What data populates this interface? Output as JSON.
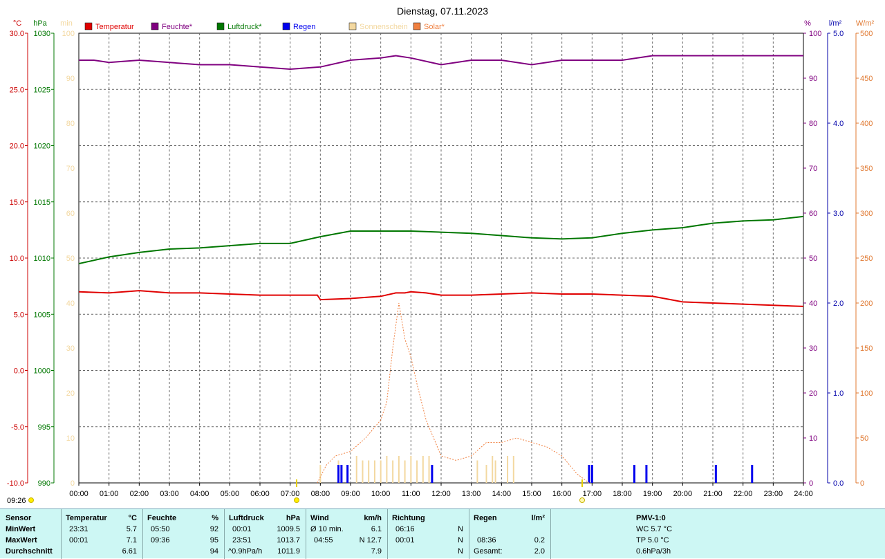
{
  "title": "Dienstag, 07.11.2023",
  "axes": {
    "temp": {
      "unit": "°C",
      "ticks": [
        "30.0",
        "25.0",
        "20.0",
        "15.0",
        "10.0",
        "5.0",
        "0.0",
        "-5.0",
        "-10.0"
      ],
      "color": "#cc0000"
    },
    "pres": {
      "unit": "hPa",
      "ticks": [
        "1030",
        "1025",
        "1020",
        "1015",
        "1010",
        "1005",
        "1000",
        "995",
        "990"
      ],
      "color": "#007700"
    },
    "min": {
      "unit": "min",
      "ticks": [
        "100",
        "90",
        "80",
        "70",
        "60",
        "50",
        "40",
        "30",
        "20",
        "10",
        "0"
      ],
      "color": "#f3d8a0"
    },
    "hum": {
      "unit": "%",
      "ticks": [
        "100",
        "90",
        "80",
        "70",
        "60",
        "50",
        "40",
        "30",
        "20",
        "10",
        "0"
      ],
      "color": "#800080"
    },
    "rain": {
      "unit": "l/m²",
      "ticks": [
        "5.0",
        "4.0",
        "3.0",
        "2.0",
        "1.0",
        "0.0"
      ],
      "color": "#0000aa"
    },
    "solar": {
      "unit": "W/m²",
      "ticks": [
        "500",
        "450",
        "400",
        "350",
        "300",
        "250",
        "200",
        "150",
        "100",
        "50",
        "0"
      ],
      "color": "#e07830"
    },
    "x_ticks": [
      "00:00",
      "01:00",
      "02:00",
      "03:00",
      "04:00",
      "05:00",
      "06:00",
      "07:00",
      "08:00",
      "09:00",
      "10:00",
      "11:00",
      "12:00",
      "13:00",
      "14:00",
      "15:00",
      "16:00",
      "17:00",
      "18:00",
      "19:00",
      "20:00",
      "21:00",
      "22:00",
      "23:00",
      "24:00"
    ]
  },
  "legend": [
    {
      "label": "Temperatur",
      "color": "#e00000"
    },
    {
      "label": "Feuchte*",
      "color": "#800080"
    },
    {
      "label": "Luftdruck*",
      "color": "#007700"
    },
    {
      "label": "Regen",
      "color": "#0000ee"
    },
    {
      "label": "Sonnenschein",
      "color": "#f3d8a0"
    },
    {
      "label": "Solar*",
      "color": "#f08040"
    }
  ],
  "sun": {
    "time_label": "09:26"
  },
  "chart_data": {
    "type": "line",
    "title": "Dienstag, 07.11.2023",
    "x_range": [
      "00:00",
      "24:00"
    ],
    "grid": true,
    "legend_position": "top",
    "series": [
      {
        "name": "Temperatur",
        "unit": "°C",
        "y_range": [
          -10,
          30
        ],
        "points": [
          [
            0,
            7.0
          ],
          [
            1,
            6.9
          ],
          [
            2,
            7.1
          ],
          [
            3,
            6.9
          ],
          [
            4,
            6.9
          ],
          [
            5,
            6.8
          ],
          [
            6,
            6.7
          ],
          [
            7,
            6.7
          ],
          [
            7.9,
            6.7
          ],
          [
            8.0,
            6.3
          ],
          [
            9,
            6.4
          ],
          [
            10,
            6.6
          ],
          [
            10.5,
            6.9
          ],
          [
            10.8,
            6.9
          ],
          [
            11,
            7.0
          ],
          [
            11.5,
            6.9
          ],
          [
            12,
            6.7
          ],
          [
            13,
            6.7
          ],
          [
            14,
            6.8
          ],
          [
            15,
            6.9
          ],
          [
            16,
            6.8
          ],
          [
            17,
            6.8
          ],
          [
            18,
            6.7
          ],
          [
            19,
            6.6
          ],
          [
            20,
            6.1
          ],
          [
            21,
            6.0
          ],
          [
            22,
            5.9
          ],
          [
            23,
            5.8
          ],
          [
            24,
            5.7
          ]
        ]
      },
      {
        "name": "Feuchte*",
        "unit": "%",
        "y_range": [
          0,
          100
        ],
        "points": [
          [
            0,
            94
          ],
          [
            0.5,
            94
          ],
          [
            1,
            93.5
          ],
          [
            2,
            94
          ],
          [
            3,
            93.5
          ],
          [
            4,
            93
          ],
          [
            5,
            93
          ],
          [
            6,
            92.5
          ],
          [
            7,
            92
          ],
          [
            8,
            92.5
          ],
          [
            9,
            94
          ],
          [
            10,
            94.5
          ],
          [
            10.5,
            95
          ],
          [
            11,
            94.5
          ],
          [
            12,
            93
          ],
          [
            13,
            94
          ],
          [
            14,
            94
          ],
          [
            15,
            93
          ],
          [
            16,
            94
          ],
          [
            17,
            94
          ],
          [
            18,
            94
          ],
          [
            18.5,
            94.5
          ],
          [
            19,
            95
          ],
          [
            20,
            95
          ],
          [
            24,
            95
          ]
        ]
      },
      {
        "name": "Luftdruck*",
        "unit": "hPa",
        "y_range": [
          990,
          1030
        ],
        "points": [
          [
            0,
            1009.5
          ],
          [
            1,
            1010.1
          ],
          [
            2,
            1010.5
          ],
          [
            3,
            1010.8
          ],
          [
            4,
            1010.9
          ],
          [
            5,
            1011.1
          ],
          [
            6,
            1011.3
          ],
          [
            7,
            1011.3
          ],
          [
            8,
            1011.9
          ],
          [
            9,
            1012.4
          ],
          [
            10,
            1012.4
          ],
          [
            11,
            1012.4
          ],
          [
            12,
            1012.3
          ],
          [
            13,
            1012.2
          ],
          [
            14,
            1012.0
          ],
          [
            15,
            1011.8
          ],
          [
            16,
            1011.7
          ],
          [
            17,
            1011.8
          ],
          [
            18,
            1012.2
          ],
          [
            19,
            1012.5
          ],
          [
            20,
            1012.7
          ],
          [
            21,
            1013.1
          ],
          [
            22,
            1013.3
          ],
          [
            23,
            1013.4
          ],
          [
            24,
            1013.7
          ]
        ]
      },
      {
        "name": "Solar*",
        "unit": "W/m²",
        "y_range": [
          0,
          500
        ],
        "points": [
          [
            7.9,
            0
          ],
          [
            8.2,
            20
          ],
          [
            8.5,
            30
          ],
          [
            9,
            35
          ],
          [
            9.5,
            50
          ],
          [
            10,
            70
          ],
          [
            10.2,
            90
          ],
          [
            10.4,
            150
          ],
          [
            10.6,
            200
          ],
          [
            10.8,
            160
          ],
          [
            11,
            140
          ],
          [
            11.2,
            110
          ],
          [
            11.5,
            70
          ],
          [
            12,
            30
          ],
          [
            12.5,
            25
          ],
          [
            13,
            30
          ],
          [
            13.5,
            45
          ],
          [
            14,
            45
          ],
          [
            14.5,
            50
          ],
          [
            15,
            45
          ],
          [
            15.5,
            40
          ],
          [
            16,
            30
          ],
          [
            16.5,
            10
          ],
          [
            16.9,
            0
          ]
        ]
      },
      {
        "name": "Regen",
        "unit": "l/m²",
        "y_range": [
          0,
          5
        ],
        "points": [
          [
            8.6,
            0.2
          ],
          [
            8.7,
            0.2
          ],
          [
            8.9,
            0.2
          ],
          [
            11.7,
            0.2
          ],
          [
            16.9,
            0.2
          ],
          [
            17.0,
            0.2
          ],
          [
            18.4,
            0.2
          ],
          [
            18.8,
            0.2
          ],
          [
            21.1,
            0.2
          ],
          [
            22.3,
            0.2
          ]
        ]
      },
      {
        "name": "Sonnenschein",
        "unit": "min",
        "y_range": [
          0,
          100
        ],
        "points": [
          [
            8.0,
            4
          ],
          [
            8.6,
            5
          ],
          [
            9.2,
            6
          ],
          [
            9.4,
            5
          ],
          [
            9.6,
            5
          ],
          [
            9.8,
            5
          ],
          [
            10,
            5
          ],
          [
            10.2,
            6
          ],
          [
            10.4,
            5
          ],
          [
            10.6,
            6
          ],
          [
            10.8,
            5
          ],
          [
            11,
            6
          ],
          [
            11.2,
            5
          ],
          [
            11.4,
            6
          ],
          [
            11.6,
            6
          ],
          [
            13.2,
            5
          ],
          [
            13.5,
            4
          ],
          [
            13.7,
            6
          ],
          [
            13.8,
            5
          ],
          [
            14.2,
            6
          ],
          [
            14.4,
            6
          ]
        ]
      }
    ]
  },
  "summary": {
    "rows": [
      "Sensor",
      "MinWert",
      "MaxWert",
      "Durchschnitt"
    ],
    "temperatur": {
      "header": "Temperatur",
      "unit": "°C",
      "min_time": "23:31",
      "min_val": "5.7",
      "max_time": "00:01",
      "max_val": "7.1",
      "avg": "6.61"
    },
    "feuchte": {
      "header": "Feuchte",
      "unit": "%",
      "min_time": "05:50",
      "min_val": "92",
      "max_time": "09:36",
      "max_val": "95",
      "avg": "94"
    },
    "luftdruck": {
      "header": "Luftdruck",
      "unit": "hPa",
      "min_time": "00:01",
      "min_val": "1009.5",
      "max_time": "23:51",
      "max_val": "1013.7",
      "trend": "^0.9hPa/h",
      "avg": "1011.9"
    },
    "wind": {
      "header": "Wind",
      "unit": "km/h",
      "min_label": "Ø 10 min.",
      "min_val": "6.1",
      "max_time": "04:55",
      "max_val": "N 12.7",
      "avg": "7.9"
    },
    "richtung": {
      "header": "Richtung",
      "min_time": "06:16",
      "min_val": "N",
      "max_time": "00:01",
      "max_val": "N",
      "avg": "N"
    },
    "regen": {
      "header": "Regen",
      "unit": "l/m²",
      "max_time": "08:36",
      "max_val": "0.2",
      "total_label": "Gesamt:",
      "total": "2.0"
    },
    "pmv": {
      "header": "PMV-1:0",
      "wc": "WC 5.7 °C",
      "tp": "TP 5.0 °C",
      "trend": "0.6hPa/3h"
    }
  }
}
